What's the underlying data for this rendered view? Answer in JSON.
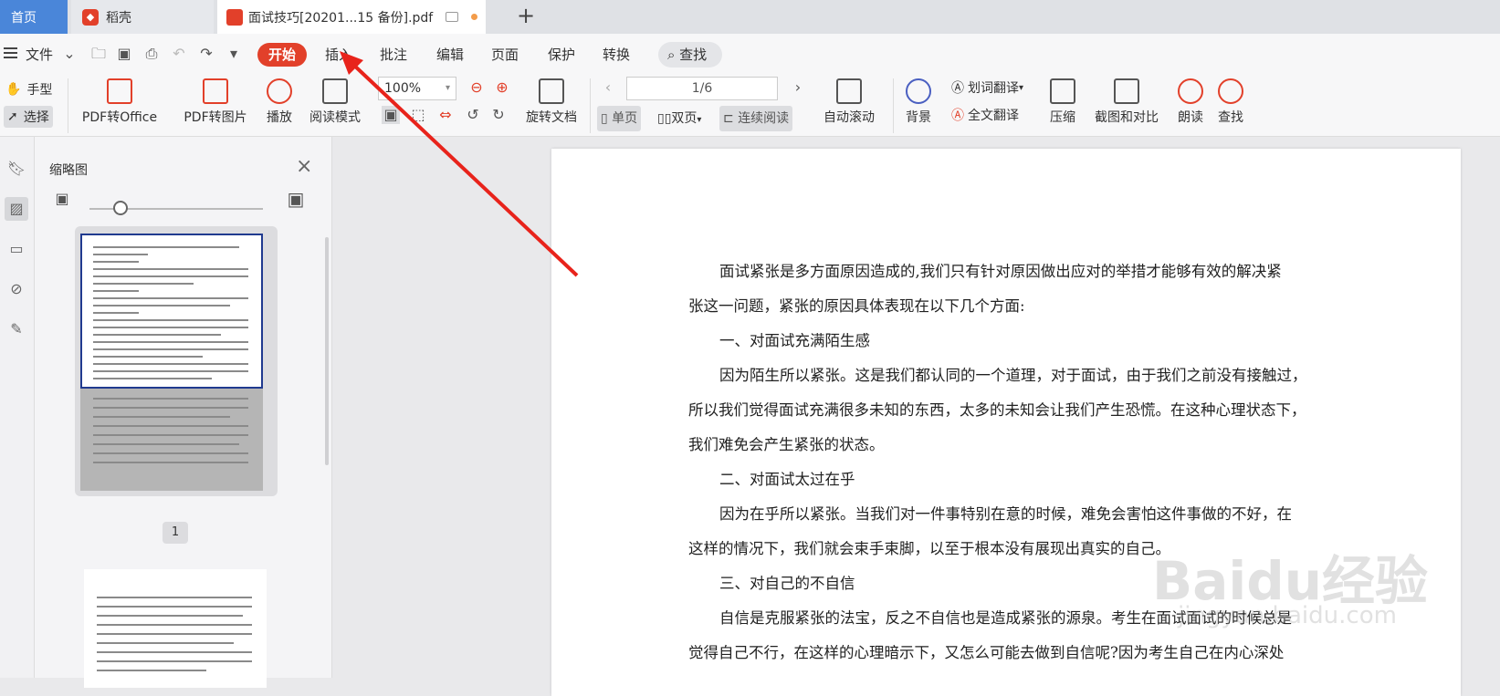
{
  "tabs": [
    {
      "label": "首页"
    },
    {
      "label": "稻壳"
    },
    {
      "label": "面试技巧[20201...15 备份].pdf"
    }
  ],
  "menu": {
    "file": "文件",
    "start": "开始",
    "insert": "插入",
    "annotate": "批注",
    "edit": "编辑",
    "page": "页面",
    "protect": "保护",
    "convert": "转换",
    "search": "查找"
  },
  "ribbon": {
    "hand": "手型",
    "select": "选择",
    "pdf_to_office": "PDF转Office",
    "pdf_to_image": "PDF转图片",
    "play": "播放",
    "read_mode": "阅读模式",
    "zoom": "100%",
    "page_indicator": "1/6",
    "rotate_doc": "旋转文档",
    "single_page": "单页",
    "double_page": "双页",
    "continuous": "连续阅读",
    "auto_scroll": "自动滚动",
    "background": "背景",
    "word_translate": "划词翻译",
    "full_translate": "全文翻译",
    "compress": "压缩",
    "screenshot_compare": "截图和对比",
    "read_aloud": "朗读",
    "find": "查找"
  },
  "thumbnails": {
    "title": "缩略图",
    "page_number": "1"
  },
  "document": {
    "lines": [
      "面试紧张是多方面原因造成的,我们只有针对原因做出应对的举措才能够有效的解决紧",
      "张这一问题，紧张的原因具体表现在以下几个方面:",
      "一、对面试充满陌生感",
      "因为陌生所以紧张。这是我们都认同的一个道理，对于面试，由于我们之前没有接触过，",
      "所以我们觉得面试充满很多未知的东西，太多的未知会让我们产生恐慌。在这种心理状态下，",
      "我们难免会产生紧张的状态。",
      "二、对面试太过在乎",
      "因为在乎所以紧张。当我们对一件事特别在意的时候，难免会害怕这件事做的不好，在",
      "这样的情况下，我们就会束手束脚，以至于根本没有展现出真实的自己。",
      "三、对自己的不自信",
      "自信是克服紧张的法宝，反之不自信也是造成紧张的源泉。考生在面试面试的时候总是",
      "觉得自己不行，在这样的心理暗示下，又怎么可能去做到自信呢?因为考生自己在内心深处"
    ]
  },
  "watermark": {
    "main": "Baidu经验",
    "sub": "jingyan.baidu.com"
  },
  "colors": {
    "accent": "#e2402a",
    "home_tab": "#4a86d9",
    "annotation_arrow": "#e8231b"
  }
}
